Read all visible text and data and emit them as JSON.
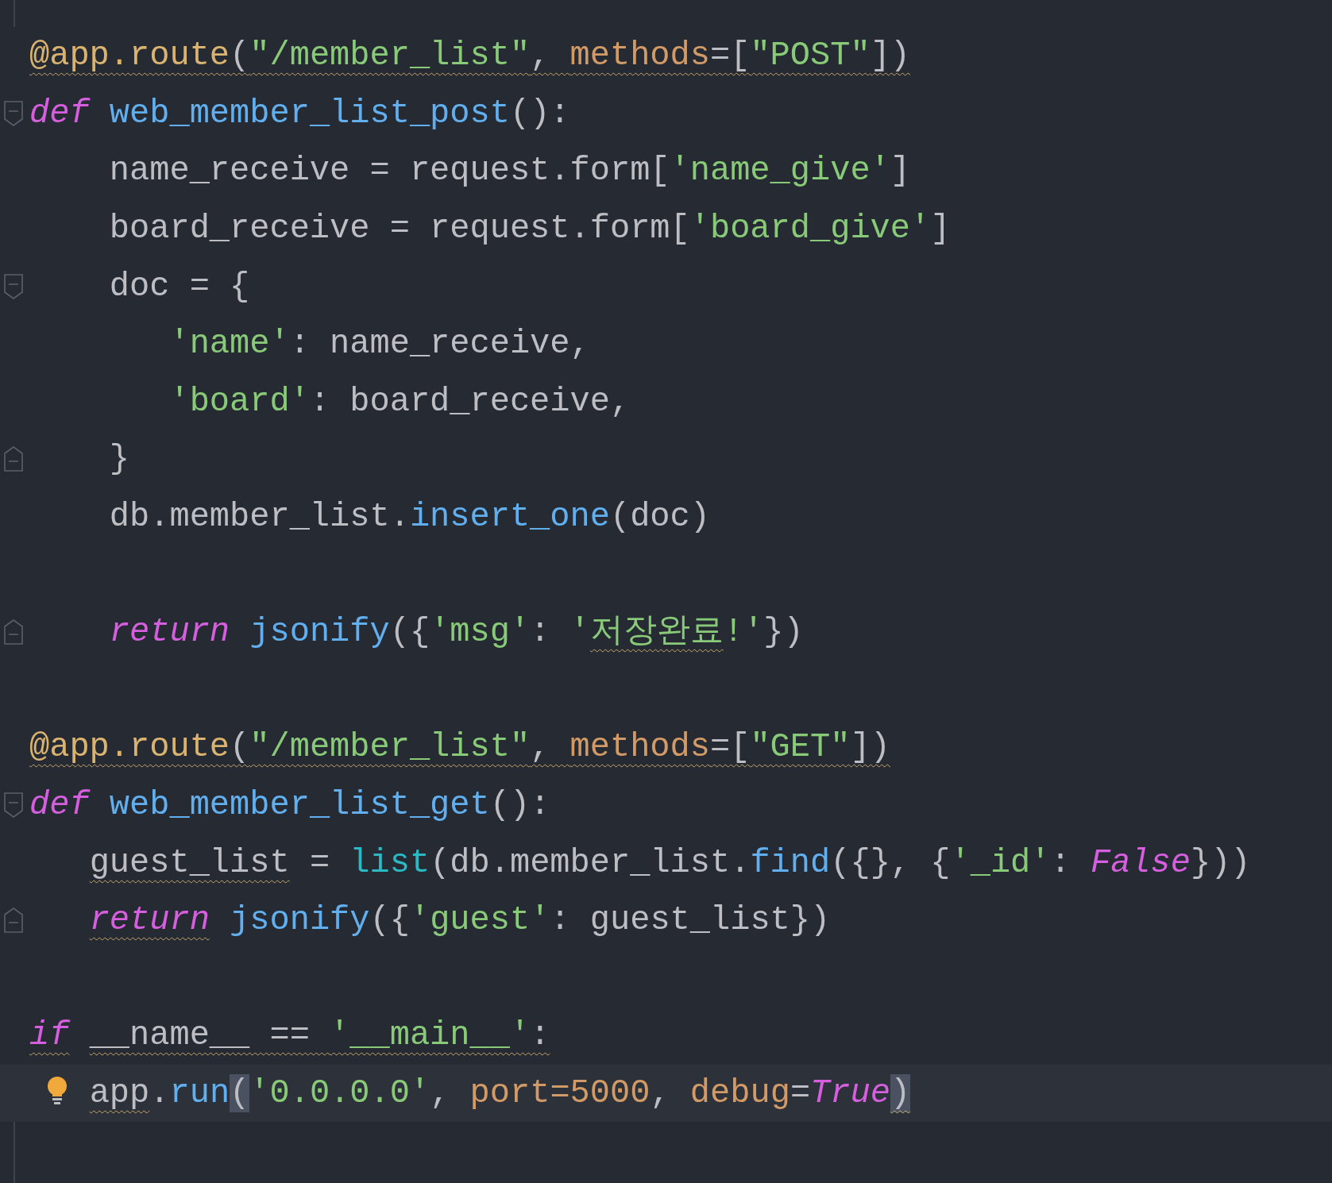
{
  "editor": {
    "lines": [
      {
        "fold_start": false,
        "fold_end": false,
        "current": false,
        "tokens": [
          {
            "text": "@app.route",
            "color": "#d9b36f",
            "kind": "normal",
            "warning": true
          },
          {
            "text": "(",
            "color": "#bcbec4",
            "kind": "normal",
            "warning": true
          },
          {
            "text": "\"/member_list\"",
            "color": "#89ca78",
            "kind": "normal",
            "warning": true
          },
          {
            "text": ", ",
            "color": "#bcbec4",
            "kind": "normal",
            "warning": true
          },
          {
            "text": "methods",
            "color": "#d19a66",
            "kind": "normal",
            "warning": true
          },
          {
            "text": "=[",
            "color": "#bcbec4",
            "kind": "normal",
            "warning": true
          },
          {
            "text": "\"POST\"",
            "color": "#89ca78",
            "kind": "normal",
            "warning": true
          },
          {
            "text": "])",
            "color": "#bcbec4",
            "kind": "normal",
            "warning": true
          }
        ]
      },
      {
        "fold_start": true,
        "fold_end": false,
        "current": false,
        "tokens": [
          {
            "text": "def",
            "color": "#d55fde",
            "kind": "italic",
            "warning": false
          },
          {
            "text": " web_member_list_post",
            "color": "#61afef",
            "kind": "normal",
            "warning": false
          },
          {
            "text": "():",
            "color": "#bcbec4",
            "kind": "normal",
            "warning": false
          }
        ]
      },
      {
        "fold_start": false,
        "fold_end": false,
        "current": false,
        "tokens": [
          {
            "text": "    name_receive = request.form[",
            "color": "#bcbec4",
            "kind": "normal",
            "warning": false
          },
          {
            "text": "'name_give'",
            "color": "#89ca78",
            "kind": "normal",
            "warning": false
          },
          {
            "text": "]",
            "color": "#bcbec4",
            "kind": "normal",
            "warning": false
          }
        ]
      },
      {
        "fold_start": false,
        "fold_end": false,
        "current": false,
        "tokens": [
          {
            "text": "    board_receive = request.form[",
            "color": "#bcbec4",
            "kind": "normal",
            "warning": false
          },
          {
            "text": "'board_give'",
            "color": "#89ca78",
            "kind": "normal",
            "warning": false
          },
          {
            "text": "]",
            "color": "#bcbec4",
            "kind": "normal",
            "warning": false
          }
        ]
      },
      {
        "fold_start": true,
        "fold_end": false,
        "current": false,
        "tokens": [
          {
            "text": "    doc = {",
            "color": "#bcbec4",
            "kind": "normal",
            "warning": false
          }
        ]
      },
      {
        "fold_start": false,
        "fold_end": false,
        "current": false,
        "tokens": [
          {
            "text": "       'name'",
            "color": "#89ca78",
            "kind": "normal",
            "warning": false
          },
          {
            "text": ": name_receive,",
            "color": "#bcbec4",
            "kind": "normal",
            "warning": false
          }
        ]
      },
      {
        "fold_start": false,
        "fold_end": false,
        "current": false,
        "tokens": [
          {
            "text": "       'board'",
            "color": "#89ca78",
            "kind": "normal",
            "warning": false
          },
          {
            "text": ": board_receive,",
            "color": "#bcbec4",
            "kind": "normal",
            "warning": false
          }
        ]
      },
      {
        "fold_start": false,
        "fold_end": true,
        "current": false,
        "tokens": [
          {
            "text": "    }",
            "color": "#bcbec4",
            "kind": "normal",
            "warning": false
          }
        ]
      },
      {
        "fold_start": false,
        "fold_end": false,
        "current": false,
        "tokens": [
          {
            "text": "    db.member_list.",
            "color": "#bcbec4",
            "kind": "normal",
            "warning": false
          },
          {
            "text": "insert_one",
            "color": "#61afef",
            "kind": "normal",
            "warning": false
          },
          {
            "text": "(doc)",
            "color": "#bcbec4",
            "kind": "normal",
            "warning": false
          }
        ]
      },
      {
        "fold_start": false,
        "fold_end": false,
        "current": false
      },
      {
        "fold_start": false,
        "fold_end": true,
        "current": false,
        "tokens": [
          {
            "text": "    return",
            "color": "#d55fde",
            "kind": "italic",
            "warning": false
          },
          {
            "text": " jsonify",
            "color": "#61afef",
            "kind": "normal",
            "warning": false
          },
          {
            "text": "({",
            "color": "#bcbec4",
            "kind": "normal",
            "warning": false
          },
          {
            "text": "'msg'",
            "color": "#89ca78",
            "kind": "normal",
            "warning": false
          },
          {
            "text": ": ",
            "color": "#bcbec4",
            "kind": "normal",
            "warning": false
          },
          {
            "text": "'",
            "color": "#89ca78",
            "kind": "normal",
            "warning": false
          },
          {
            "text": "저장완료",
            "color": "#89ca78",
            "kind": "normal",
            "warning": true
          },
          {
            "text": "!'",
            "color": "#89ca78",
            "kind": "normal",
            "warning": false
          },
          {
            "text": "})",
            "color": "#bcbec4",
            "kind": "normal",
            "warning": false
          }
        ]
      },
      {
        "fold_start": false,
        "fold_end": false,
        "current": false
      },
      {
        "fold_start": false,
        "fold_end": false,
        "current": false,
        "tokens": [
          {
            "text": "@app.route",
            "color": "#d9b36f",
            "kind": "normal",
            "warning": true
          },
          {
            "text": "(",
            "color": "#bcbec4",
            "kind": "normal",
            "warning": true
          },
          {
            "text": "\"/member_list\"",
            "color": "#89ca78",
            "kind": "normal",
            "warning": true
          },
          {
            "text": ", ",
            "color": "#bcbec4",
            "kind": "normal",
            "warning": true
          },
          {
            "text": "methods",
            "color": "#d19a66",
            "kind": "normal",
            "warning": true
          },
          {
            "text": "=[",
            "color": "#bcbec4",
            "kind": "normal",
            "warning": true
          },
          {
            "text": "\"GET\"",
            "color": "#89ca78",
            "kind": "normal",
            "warning": true
          },
          {
            "text": "])",
            "color": "#bcbec4",
            "kind": "normal",
            "warning": true
          }
        ]
      },
      {
        "fold_start": true,
        "fold_end": false,
        "current": false,
        "tokens": [
          {
            "text": "def",
            "color": "#d55fde",
            "kind": "italic",
            "warning": false
          },
          {
            "text": " web_member_list_get",
            "color": "#61afef",
            "kind": "normal",
            "warning": false
          },
          {
            "text": "():",
            "color": "#bcbec4",
            "kind": "normal",
            "warning": false
          }
        ]
      },
      {
        "fold_start": false,
        "fold_end": false,
        "current": false,
        "tokens": [
          {
            "text": "   guest_list",
            "color": "#bcbec4",
            "kind": "normal",
            "warning": true
          },
          {
            "text": " = ",
            "color": "#bcbec4",
            "kind": "normal",
            "warning": false
          },
          {
            "text": "list",
            "color": "#2bbac5",
            "kind": "normal",
            "warning": false
          },
          {
            "text": "(db.member_list.",
            "color": "#bcbec4",
            "kind": "normal",
            "warning": false
          },
          {
            "text": "find",
            "color": "#61afef",
            "kind": "normal",
            "warning": false
          },
          {
            "text": "({}, {",
            "color": "#bcbec4",
            "kind": "normal",
            "warning": false
          },
          {
            "text": "'_id'",
            "color": "#89ca78",
            "kind": "normal",
            "warning": false
          },
          {
            "text": ": ",
            "color": "#bcbec4",
            "kind": "normal",
            "warning": false
          },
          {
            "text": "False",
            "color": "#d55fde",
            "kind": "italic",
            "warning": false
          },
          {
            "text": "}))",
            "color": "#bcbec4",
            "kind": "normal",
            "warning": false
          }
        ]
      },
      {
        "fold_start": false,
        "fold_end": true,
        "current": false,
        "tokens": [
          {
            "text": "   return",
            "color": "#d55fde",
            "kind": "italic",
            "warning": true
          },
          {
            "text": " jsonify",
            "color": "#61afef",
            "kind": "normal",
            "warning": false
          },
          {
            "text": "({",
            "color": "#bcbec4",
            "kind": "normal",
            "warning": false
          },
          {
            "text": "'guest'",
            "color": "#89ca78",
            "kind": "normal",
            "warning": false
          },
          {
            "text": ": guest_list})",
            "color": "#bcbec4",
            "kind": "normal",
            "warning": false
          }
        ]
      },
      {
        "fold_start": false,
        "fold_end": false,
        "current": false
      },
      {
        "fold_start": false,
        "fold_end": false,
        "current": false,
        "tokens": [
          {
            "text": "if",
            "color": "#d55fde",
            "kind": "italic",
            "warning": true
          },
          {
            "text": " __name__ == ",
            "color": "#bcbec4",
            "kind": "normal",
            "warning": true
          },
          {
            "text": "'__main__'",
            "color": "#89ca78",
            "kind": "normal",
            "warning": true
          },
          {
            "text": ":",
            "color": "#bcbec4",
            "kind": "normal",
            "warning": true
          }
        ]
      },
      {
        "fold_start": false,
        "fold_end": false,
        "current": true,
        "tokens": [
          {
            "text": "   app",
            "color": "#bcbec4",
            "kind": "normal",
            "warning": true
          },
          {
            "text": ".",
            "color": "#bcbec4",
            "kind": "normal",
            "warning": false
          },
          {
            "text": "run",
            "color": "#61afef",
            "kind": "normal",
            "warning": false
          },
          {
            "text": "(",
            "color": "#4a5262",
            "kind": "brace",
            "warning": false
          },
          {
            "text": "'0.0.0.0'",
            "color": "#89ca78",
            "kind": "normal",
            "warning": false
          },
          {
            "text": ", ",
            "color": "#bcbec4",
            "kind": "normal",
            "warning": false
          },
          {
            "text": "port=5000",
            "color": "#d19a66",
            "kind": "normal",
            "warning": false
          },
          {
            "text": ", ",
            "color": "#bcbec4",
            "kind": "normal",
            "warning": false
          },
          {
            "text": "debug",
            "color": "#d19a66",
            "kind": "normal",
            "warning": false
          },
          {
            "text": "=",
            "color": "#bcbec4",
            "kind": "normal",
            "warning": false
          },
          {
            "text": "True",
            "color": "#d55fde",
            "kind": "italic",
            "warning": false
          },
          {
            "text": ")",
            "color": "#4a5262",
            "kind": "brace",
            "warning": true
          }
        ]
      }
    ]
  }
}
